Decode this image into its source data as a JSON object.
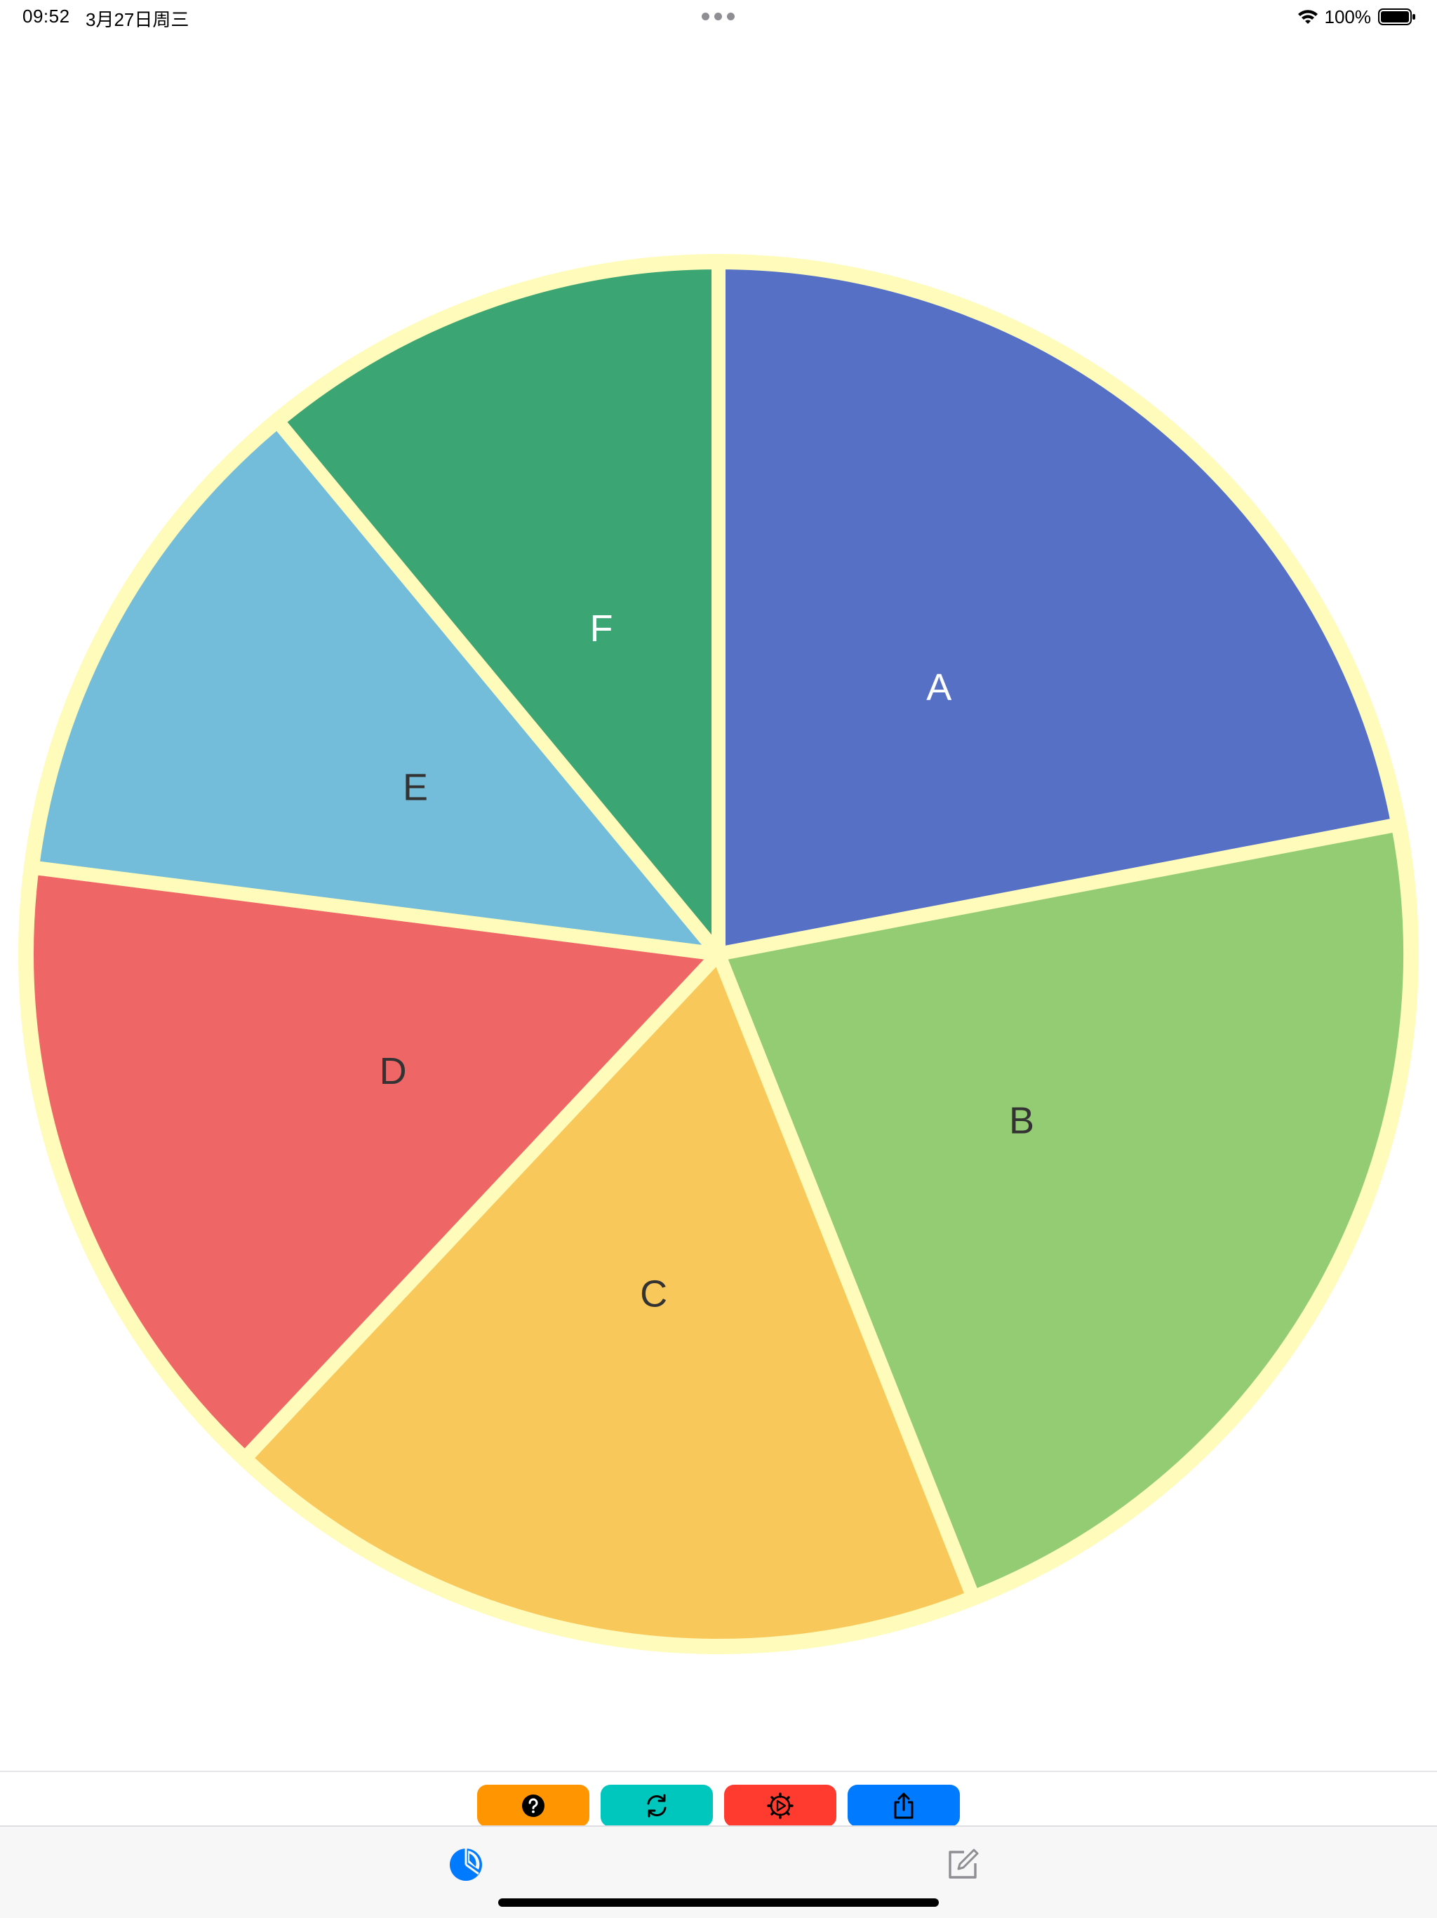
{
  "status_bar": {
    "time": "09:52",
    "date": "3月27日周三",
    "battery_percent": "100%",
    "battery_level": 1.0
  },
  "chart_data": {
    "type": "pie",
    "title": "",
    "start_angle": "12 o'clock",
    "direction": "clockwise",
    "slices": [
      {
        "label": "A",
        "percent": 22,
        "color": "#5570c4"
      },
      {
        "label": "B",
        "percent": 22,
        "color": "#94cc74"
      },
      {
        "label": "C",
        "percent": 18,
        "color": "#f9c85a"
      },
      {
        "label": "D",
        "percent": 15,
        "color": "#ef6667"
      },
      {
        "label": "E",
        "percent": 12,
        "color": "#73bdda"
      },
      {
        "label": "F",
        "percent": 11,
        "color": "#3ca574"
      }
    ],
    "border_color": "#fffbba",
    "label_colors": [
      "#ffffff",
      "#333333",
      "#333333",
      "#333333",
      "#333333",
      "#ffffff"
    ]
  },
  "action_bar": {
    "buttons": [
      {
        "name": "help",
        "icon": "question-circle-icon",
        "color": "#ff9500"
      },
      {
        "name": "refresh",
        "icon": "refresh-arrows-icon",
        "color": "#00c7be"
      },
      {
        "name": "settings",
        "icon": "gear-play-icon",
        "color": "#ff3b30"
      },
      {
        "name": "share",
        "icon": "share-icon",
        "color": "#007aff"
      }
    ]
  },
  "tab_bar": {
    "tabs": [
      {
        "name": "chart",
        "icon": "pie-chart-icon",
        "color": "#007aff",
        "selected": true
      },
      {
        "name": "edit",
        "icon": "edit-icon",
        "color": "#8e8e93",
        "selected": false
      }
    ]
  }
}
